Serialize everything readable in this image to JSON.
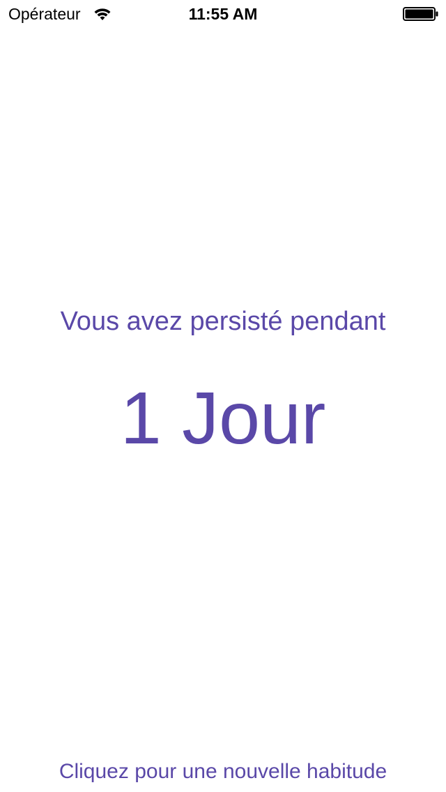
{
  "status_bar": {
    "carrier": "Opérateur",
    "time": "11:55 AM",
    "wifi_icon": "wifi-icon",
    "battery_icon": "battery-icon"
  },
  "main": {
    "subtitle": "Vous avez persisté pendant",
    "counter": "1 Jour",
    "new_habit_link": "Cliquez pour une nouvelle habitude"
  },
  "colors": {
    "accent": "#5a48a8",
    "background": "#ffffff",
    "status_text": "#000000"
  }
}
